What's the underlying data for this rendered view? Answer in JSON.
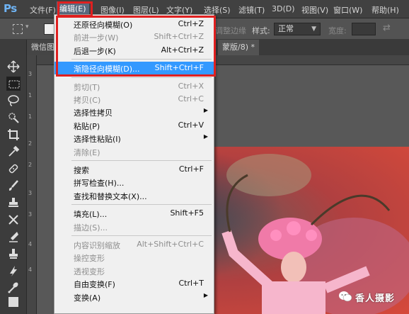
{
  "app": {
    "logo": "Ps"
  },
  "menubar": [
    {
      "label": "文件(F)",
      "active": false
    },
    {
      "label": "编辑(E)",
      "active": true
    },
    {
      "label": "图像(I)",
      "active": false
    },
    {
      "label": "图层(L)",
      "active": false
    },
    {
      "label": "文字(Y)",
      "active": false
    },
    {
      "label": "选择(S)",
      "active": false
    },
    {
      "label": "滤镜(T)",
      "active": false
    },
    {
      "label": "3D(D)",
      "active": false
    },
    {
      "label": "视图(V)",
      "active": false
    },
    {
      "label": "窗口(W)",
      "active": false
    },
    {
      "label": "帮助(H)",
      "active": false
    }
  ],
  "options": {
    "partial_label": "调整边缘",
    "style_label": "样式:",
    "style_value": "正常",
    "width_label": "宽度:"
  },
  "tabs": [
    {
      "label": "微信图片"
    },
    {
      "label": "蒙版/8) *"
    }
  ],
  "rulers": {
    "left_ticks": [
      "3",
      "1",
      "1",
      "2",
      "2",
      "3",
      "3",
      "4",
      "4"
    ]
  },
  "dropdown": {
    "items": [
      {
        "label": "还原径向模糊(O)",
        "shortcut": "Ctrl+Z",
        "disabled": false,
        "submenu": false,
        "highlight": false
      },
      {
        "label": "前进一步(W)",
        "shortcut": "Shift+Ctrl+Z",
        "disabled": true,
        "submenu": false,
        "highlight": false
      },
      {
        "label": "后退一步(K)",
        "shortcut": "Alt+Ctrl+Z",
        "disabled": false,
        "submenu": false,
        "highlight": false
      },
      {
        "sep": true
      },
      {
        "label": "渐隐径向模糊(D)...",
        "shortcut": "Shift+Ctrl+F",
        "disabled": false,
        "submenu": false,
        "highlight": true
      },
      {
        "sep": true
      },
      {
        "label": "剪切(T)",
        "shortcut": "Ctrl+X",
        "disabled": true,
        "submenu": false,
        "highlight": false
      },
      {
        "label": "拷贝(C)",
        "shortcut": "Ctrl+C",
        "disabled": true,
        "submenu": false,
        "highlight": false
      },
      {
        "label": "选择性拷贝",
        "shortcut": "",
        "disabled": false,
        "submenu": true,
        "highlight": false
      },
      {
        "label": "粘贴(P)",
        "shortcut": "Ctrl+V",
        "disabled": false,
        "submenu": false,
        "highlight": false
      },
      {
        "label": "选择性粘贴(I)",
        "shortcut": "",
        "disabled": false,
        "submenu": true,
        "highlight": false
      },
      {
        "label": "清除(E)",
        "shortcut": "",
        "disabled": true,
        "submenu": false,
        "highlight": false
      },
      {
        "sep": true
      },
      {
        "label": "搜索",
        "shortcut": "Ctrl+F",
        "disabled": false,
        "submenu": false,
        "highlight": false
      },
      {
        "label": "拼写检查(H)...",
        "shortcut": "",
        "disabled": false,
        "submenu": false,
        "highlight": false
      },
      {
        "label": "查找和替换文本(X)...",
        "shortcut": "",
        "disabled": false,
        "submenu": false,
        "highlight": false
      },
      {
        "sep": true
      },
      {
        "label": "填充(L)...",
        "shortcut": "Shift+F5",
        "disabled": false,
        "submenu": false,
        "highlight": false
      },
      {
        "label": "描边(S)...",
        "shortcut": "",
        "disabled": true,
        "submenu": false,
        "highlight": false
      },
      {
        "sep": true
      },
      {
        "label": "内容识别缩放",
        "shortcut": "Alt+Shift+Ctrl+C",
        "disabled": true,
        "submenu": false,
        "highlight": false
      },
      {
        "label": "操控变形",
        "shortcut": "",
        "disabled": true,
        "submenu": false,
        "highlight": false
      },
      {
        "label": "透视变形",
        "shortcut": "",
        "disabled": true,
        "submenu": false,
        "highlight": false
      },
      {
        "label": "自由变换(F)",
        "shortcut": "Ctrl+T",
        "disabled": false,
        "submenu": false,
        "highlight": false
      },
      {
        "label": "变换(A)",
        "shortcut": "",
        "disabled": false,
        "submenu": true,
        "highlight": false
      }
    ]
  },
  "watermark": {
    "text": "香人摄影"
  },
  "colors": {
    "highlight": "#3399ff",
    "annotation": "#e02020",
    "menubar": "#414141"
  }
}
